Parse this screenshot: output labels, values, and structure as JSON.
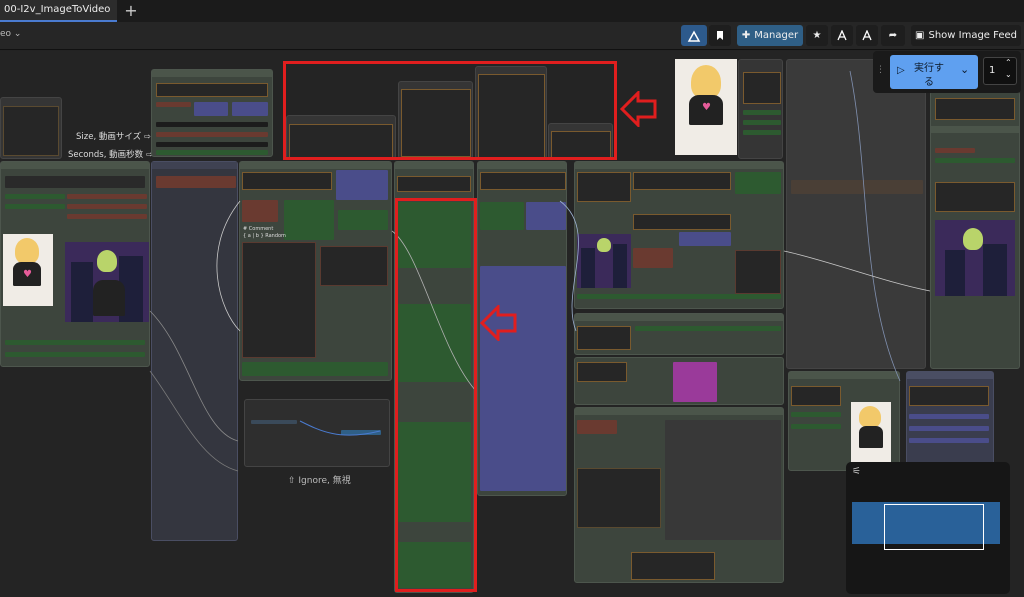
{
  "tab": {
    "title": "00-I2v_ImageToVideo"
  },
  "toolbar": {
    "workflow_suffix": "eo",
    "manager_label": "Manager",
    "show_image_feed_label": "Show Image Feed"
  },
  "queue": {
    "run_label_line1": "実行す",
    "run_label_line2": "る",
    "count": "1"
  },
  "canvas": {
    "labels": {
      "size": "Size, 動画サイズ ⇨",
      "seconds": "Seconds, 動画秒数 ⇨",
      "ignore": "⇧ Ignore, 無視",
      "comment": "# Comment",
      "random": "{ a | b } Random"
    }
  },
  "colors": {
    "highlight": "#e01e1e",
    "accent": "#4a7bd0",
    "node_green": "#3d453d",
    "node_blue": "#3a3d4e"
  },
  "icons": [
    "plus-icon",
    "logo-icon",
    "bookmark-icon",
    "puzzle-icon",
    "star-icon",
    "queue-icon",
    "share-icon",
    "image-icon",
    "play-icon",
    "chevron-down-icon",
    "drag-handle-icon",
    "sliders-icon"
  ]
}
